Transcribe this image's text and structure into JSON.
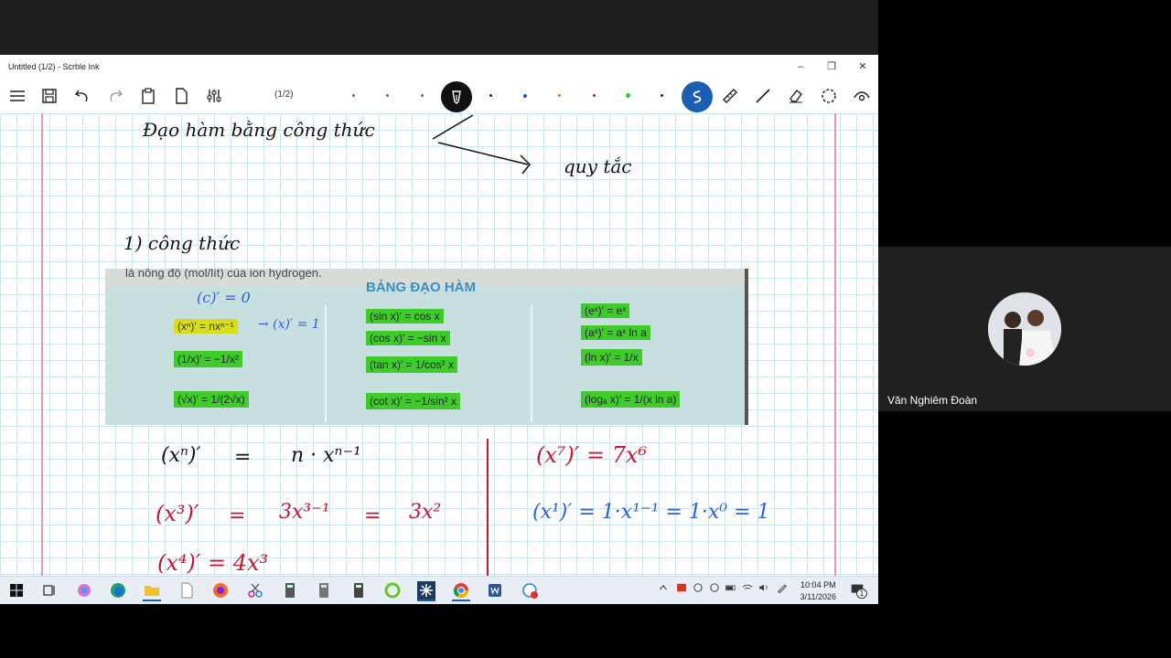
{
  "window": {
    "title": "Untitled (1/2) - Scrble Ink",
    "minimize": "–",
    "maximize": "❐",
    "close": "✕"
  },
  "toolbar": {
    "page_indicator": "(1/2)"
  },
  "pen_colors": [
    "#666666",
    "#666666",
    "#666666",
    "#222222",
    "#1a4fd1",
    "#e0641a",
    "#b3153a",
    "#2ecc2e",
    "#222222"
  ],
  "notes": {
    "heading_left": "Đạo hàm bằng công thức",
    "heading_right": "quy tắc",
    "section": "1) công thức",
    "left_eq1_lhs": "(xⁿ)′",
    "left_eq1_eq": "=",
    "left_eq1_rhs": "n · xⁿ⁻¹",
    "left_eq2_lhs": "(x³)′",
    "left_eq2_eq": "=",
    "left_eq2_mid": "3x³⁻¹",
    "left_eq2_eq2": "=",
    "left_eq2_rhs": "3x²",
    "left_eq3": "(x⁴)′ = 4x³",
    "right_eq1": "(x⁷)′ = 7x⁶",
    "right_eq2": "(x¹)′ = 1·x¹⁻¹ = 1·x⁰ = 1"
  },
  "photo": {
    "top_text": "là nồng độ (mol/lít) của ion hydrogen.",
    "title": "BẢNG ĐẠO HÀM",
    "handwritten": "(c)′ = 0",
    "handwritten2": "→ (x)′ = 1",
    "col1": [
      "(xⁿ)′ = nxⁿ⁻¹",
      "(1/x)′ = −1/x²",
      "(√x)′ = 1/(2√x)"
    ],
    "col2": [
      "(sin x)′ = cos x",
      "(cos x)′ = −sin x",
      "(tan x)′ = 1/cos² x",
      "(cot x)′ = −1/sin² x"
    ],
    "col3": [
      "(eˣ)′ = eˣ",
      "(aˣ)′ = aˣ ln a",
      "(ln x)′ = 1/x",
      "(logₐ x)′ = 1/(x ln a)"
    ]
  },
  "taskbar": {
    "time": "10:04 PM",
    "date": "3/11/2026",
    "notification_count": "1"
  },
  "participant": {
    "name": "Văn Nghiêm Đoàn"
  }
}
